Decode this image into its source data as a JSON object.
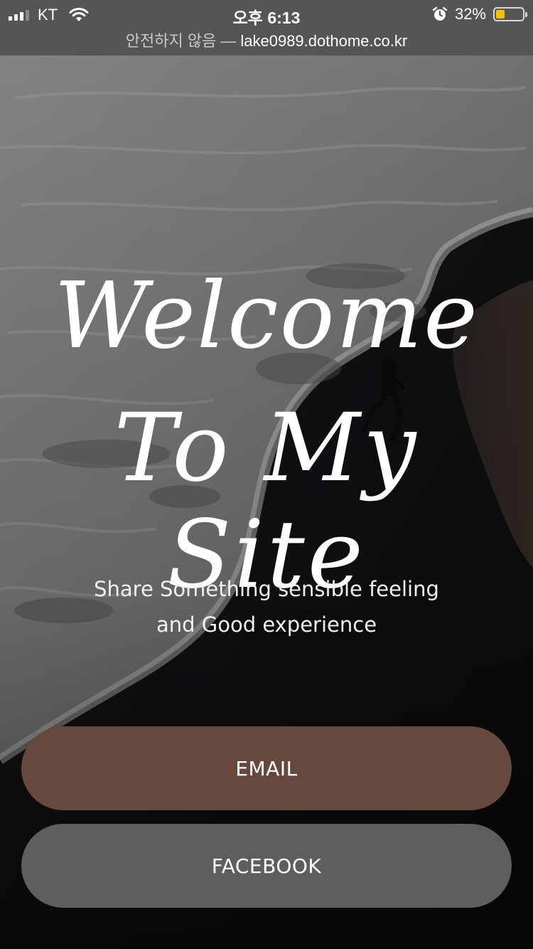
{
  "status_bar": {
    "carrier": "KT",
    "time": "오후 6:13",
    "battery_percent": "32%",
    "battery_level": 0.32,
    "battery_color": "#f3c100",
    "icons": [
      "signal-icon",
      "wifi-icon",
      "alarm-icon",
      "battery-icon"
    ]
  },
  "url_bar": {
    "security_text": "안전하지 않음",
    "separator": "—",
    "domain": "lake0989.dothome.co.kr"
  },
  "hero": {
    "title_line1": "Welcome",
    "title_line2": "To My Site",
    "tagline_line1": "Share Something sensible feeling",
    "tagline_line2": "and Good experience"
  },
  "buttons": {
    "email_label": "EMAIL",
    "facebook_label": "FACEBOOK"
  },
  "colors": {
    "email_button": "#66483f",
    "facebook_button": "#5e5e5e",
    "top_bar": "#555555"
  }
}
